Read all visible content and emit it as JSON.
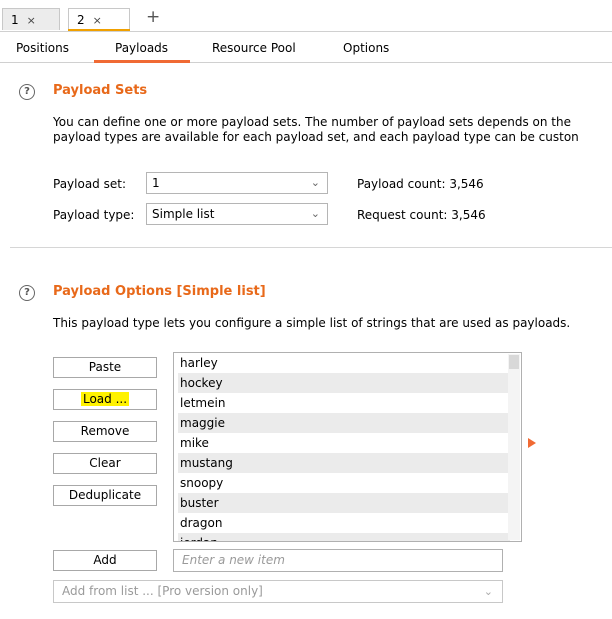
{
  "request_tabs": [
    {
      "label": "1",
      "close": "×"
    },
    {
      "label": "2",
      "close": "×",
      "active": true
    }
  ],
  "new_tab": "+",
  "subtabs": [
    "Positions",
    "Payloads",
    "Resource Pool",
    "Options"
  ],
  "active_subtab": "Payloads",
  "payload_sets": {
    "help": "?",
    "title": "Payload Sets",
    "description_line1": "You can define one or more payload sets. The number of payload sets depends on the",
    "description_line2": "payload types are available for each payload set, and each payload type can be custon",
    "payload_set_label": "Payload set:",
    "payload_set_value": "1",
    "payload_type_label": "Payload type:",
    "payload_type_value": "Simple list",
    "payload_count": "Payload count: 3,546",
    "request_count": "Request count: 3,546"
  },
  "payload_options": {
    "help": "?",
    "title": "Payload Options [Simple list]",
    "description": "This payload type lets you configure a simple list of strings that are used as payloads.",
    "buttons": {
      "paste": "Paste",
      "load": "Load ...",
      "remove": "Remove",
      "clear": "Clear",
      "deduplicate": "Deduplicate",
      "add": "Add"
    },
    "items": [
      "harley",
      "hockey",
      "letmein",
      "maggie",
      "mike",
      "mustang",
      "snoopy",
      "buster",
      "dragon",
      "jordan"
    ],
    "new_item_placeholder": "Enter a new item",
    "add_from_list": "Add from list ... [Pro version only]"
  },
  "colors": {
    "accent": "#f06a34",
    "section_title": "#e8691a",
    "highlight": "#fff200"
  }
}
